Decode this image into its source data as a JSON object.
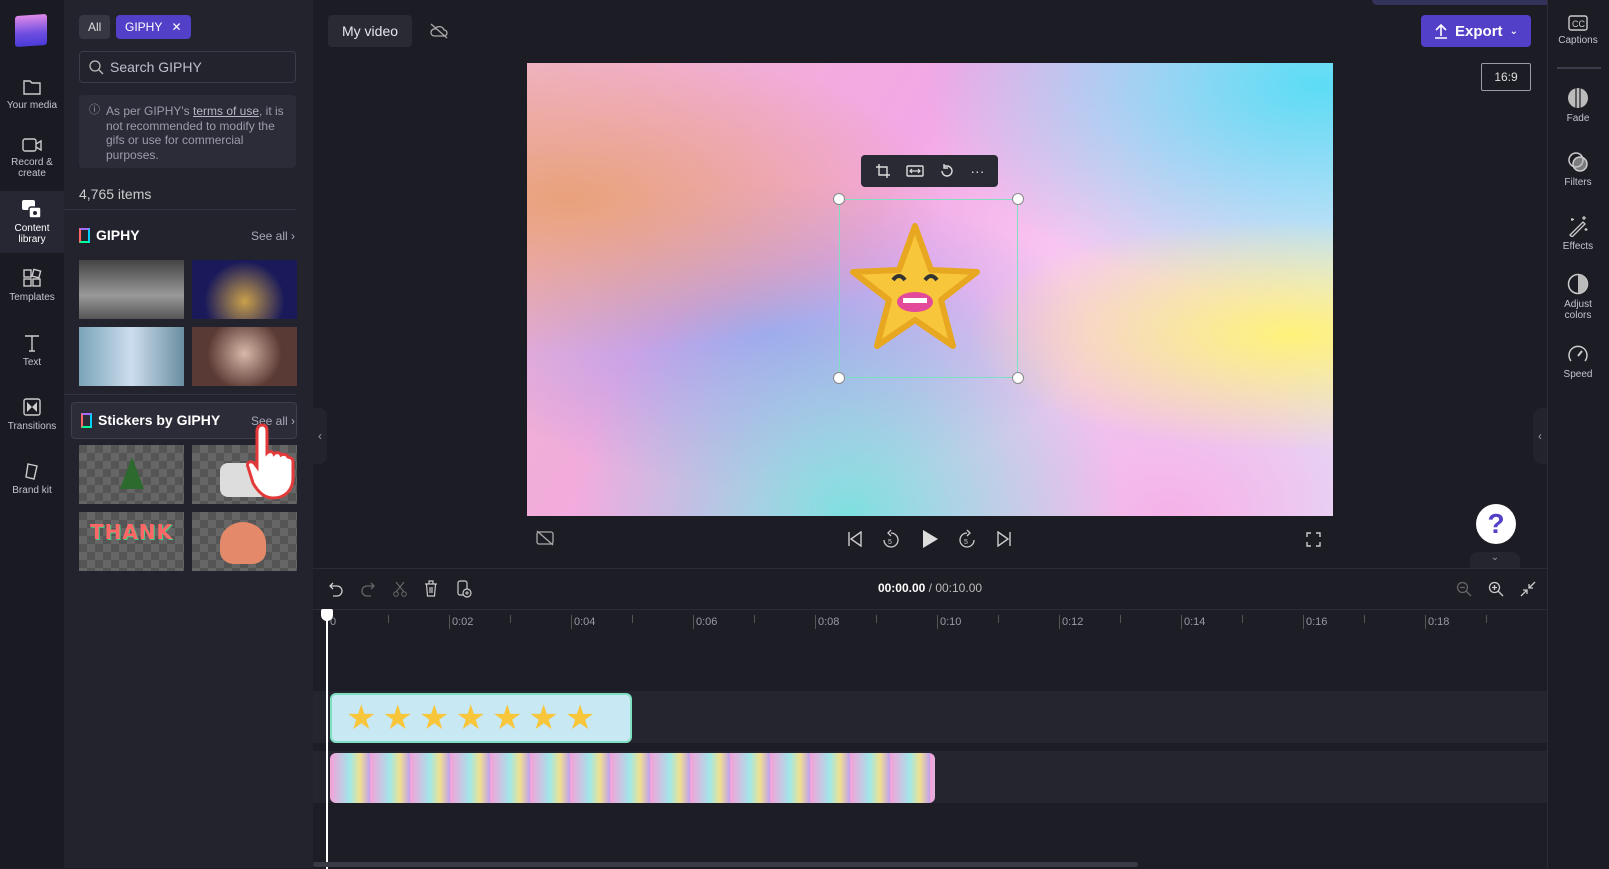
{
  "rail": {
    "items": [
      {
        "label": "Your media",
        "icon": "folder-icon"
      },
      {
        "label": "Record &\ncreate",
        "icon": "camera-icon"
      },
      {
        "label": "Content\nlibrary",
        "icon": "content-library-icon",
        "active": true
      },
      {
        "label": "Templates",
        "icon": "templates-icon"
      },
      {
        "label": "Text",
        "icon": "text-icon"
      },
      {
        "label": "Transitions",
        "icon": "transitions-icon"
      },
      {
        "label": "Brand kit",
        "icon": "brand-kit-icon"
      }
    ]
  },
  "panel": {
    "chips": {
      "all": "All",
      "giphy": "GIPHY"
    },
    "search_placeholder": "Search GIPHY",
    "notice": {
      "before": "As per GIPHY's ",
      "link": "terms of use",
      "after": ", it is not recommended to modify the gifs or use for commercial purposes."
    },
    "count": "4,765 items",
    "sections": [
      {
        "title": "GIPHY",
        "see_all": "See all"
      },
      {
        "title": "Stickers by GIPHY",
        "see_all": "See all"
      }
    ]
  },
  "topbar": {
    "title": "My video",
    "export": "Export",
    "ratio": "16:9"
  },
  "player": {
    "current": "00:00.00",
    "total": "/ 00:10.00"
  },
  "right_rail": {
    "captions": "Captions",
    "items": [
      "Fade",
      "Filters",
      "Effects",
      "Adjust\ncolors",
      "Speed"
    ]
  },
  "timeline": {
    "ticks": [
      "0",
      "0:02",
      "0:04",
      "0:06",
      "0:08",
      "0:10",
      "0:12",
      "0:14",
      "0:16",
      "0:18"
    ]
  },
  "colors": {
    "accent": "#5340c8",
    "selection": "#7ee0c0"
  }
}
